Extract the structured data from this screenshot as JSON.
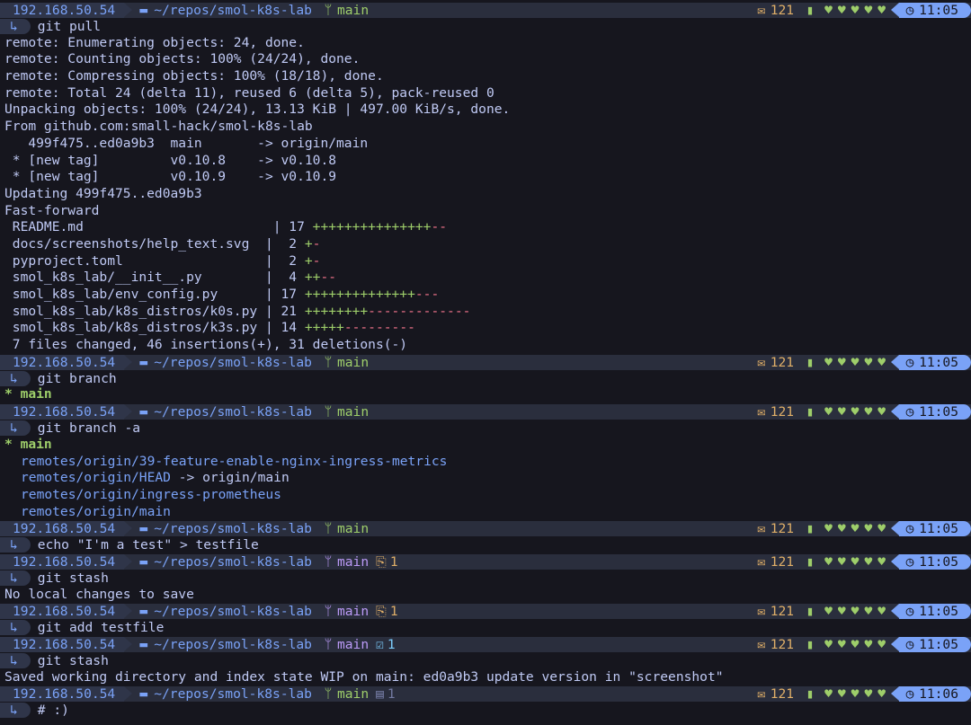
{
  "prompt": {
    "ip": "192.168.50.54",
    "dir": "~/repos/smol-k8s-lab",
    "branch": "main",
    "mail_count": "121",
    "time_a": "11:05",
    "time_b": "11:06",
    "file_count": "1",
    "arrow": "↳"
  },
  "block1": {
    "cmd": "git pull",
    "lines": [
      "remote: Enumerating objects: 24, done.",
      "remote: Counting objects: 100% (24/24), done.",
      "remote: Compressing objects: 100% (18/18), done.",
      "remote: Total 24 (delta 11), reused 6 (delta 5), pack-reused 0",
      "Unpacking objects: 100% (24/24), 13.13 KiB | 497.00 KiB/s, done.",
      "From github.com:small-hack/smol-k8s-lab",
      "   499f475..ed0a9b3  main       -> origin/main",
      " * [new tag]         v0.10.8    -> v0.10.8",
      " * [new tag]         v0.10.9    -> v0.10.9",
      "Updating 499f475..ed0a9b3",
      "Fast-forward"
    ],
    "diff": [
      {
        "file": " README.md                        | 17 ",
        "plus": "+++++++++++++++",
        "minus": "--"
      },
      {
        "file": " docs/screenshots/help_text.svg  |  2 ",
        "plus": "+",
        "minus": "-"
      },
      {
        "file": " pyproject.toml                  |  2 ",
        "plus": "+",
        "minus": "-"
      },
      {
        "file": " smol_k8s_lab/__init__.py        |  4 ",
        "plus": "++",
        "minus": "--"
      },
      {
        "file": " smol_k8s_lab/env_config.py      | 17 ",
        "plus": "++++++++++++++",
        "minus": "---"
      },
      {
        "file": " smol_k8s_lab/k8s_distros/k0s.py | 21 ",
        "plus": "++++++++",
        "minus": "-------------"
      },
      {
        "file": " smol_k8s_lab/k8s_distros/k3s.py | 14 ",
        "plus": "+++++",
        "minus": "---------"
      }
    ],
    "summary": " 7 files changed, 46 insertions(+), 31 deletions(-)"
  },
  "block2": {
    "cmd": "git branch",
    "current": "* main"
  },
  "block3": {
    "cmd": "git branch -a",
    "current": "* main",
    "remotes": [
      "remotes/origin/39-feature-enable-nginx-ingress-metrics",
      "remotes/origin/HEAD",
      "remotes/origin/ingress-prometheus",
      "remotes/origin/main"
    ],
    "head_target": " -> origin/main"
  },
  "block4": {
    "cmd": "echo \"I'm a test\" > testfile"
  },
  "block5": {
    "cmd": "git stash",
    "out": "No local changes to save"
  },
  "block6": {
    "cmd": "git add testfile"
  },
  "block7": {
    "cmd": "git stash",
    "out": "Saved working directory and index state WIP on main: ed0a9b3 update version in \"screenshot\""
  },
  "block8": {
    "cmd": "# :)"
  },
  "colors": {
    "background": "#16161e",
    "accent": "#7aa2f7",
    "green": "#9ece6a",
    "red": "#f7768e",
    "purple": "#bb9af7",
    "yellow": "#e0af68"
  }
}
